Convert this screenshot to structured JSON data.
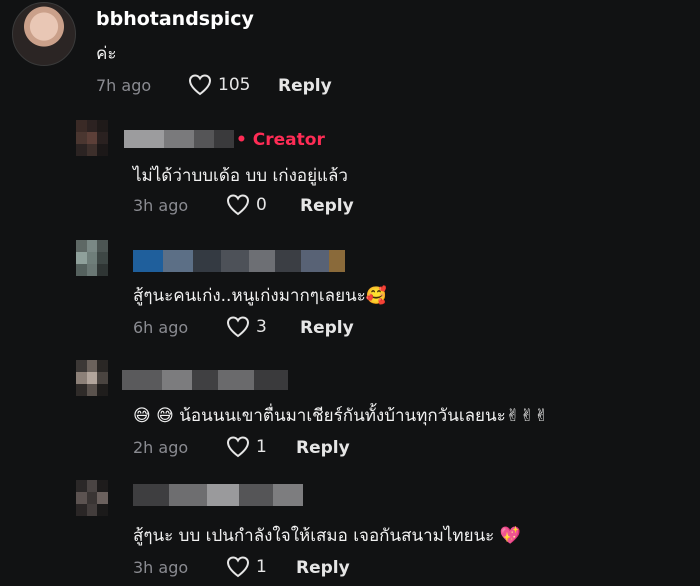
{
  "comments": [
    {
      "username": "bbhotandspicy",
      "text": "ค่ะ",
      "time": "7h ago",
      "likes": "105",
      "reply_label": "Reply"
    },
    {
      "badge": "Creator",
      "text": "ไม่ได้ว่าบบเด้อ บบ เก่งอยู่แล้ว",
      "time": "3h ago",
      "likes": "0",
      "reply_label": "Reply"
    },
    {
      "text": "สู้ๆนะคนเก่ง..หนูเก่งมากๆเลยนะ🥰",
      "time": "6h ago",
      "likes": "3",
      "reply_label": "Reply"
    },
    {
      "text": "😅 😅 น้อนนนเขาตื่นมาเชียร์กันทั้งบ้านทุกวันเลยนะ✌✌✌",
      "time": "2h ago",
      "likes": "1",
      "reply_label": "Reply"
    },
    {
      "text": "สู้ๆนะ บบ เปนกำลังใจให้เสมอ เจอกันสนามไทยนะ 💖",
      "time": "3h ago",
      "likes": "1",
      "reply_label": "Reply"
    }
  ]
}
